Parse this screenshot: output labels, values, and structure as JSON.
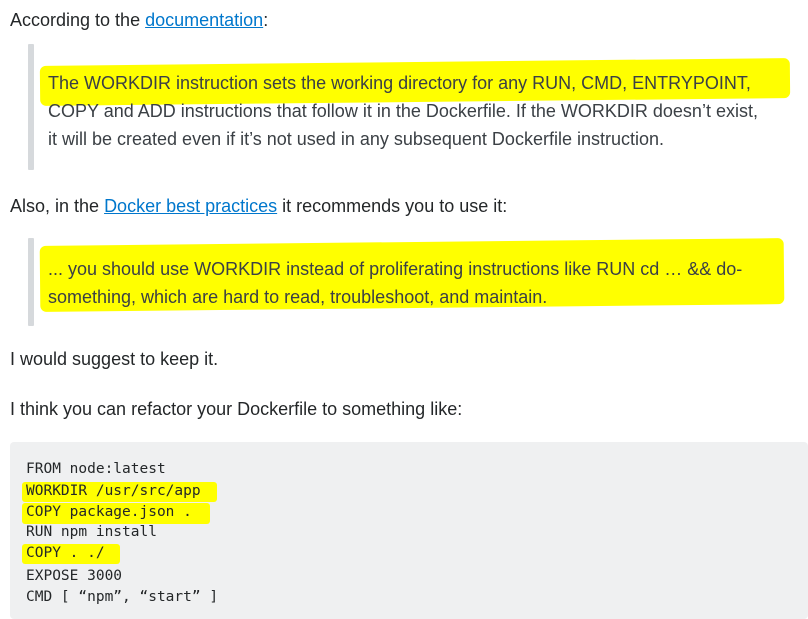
{
  "intro": {
    "prefix": "According to the ",
    "link_text": "documentation",
    "suffix": ":"
  },
  "quote1": {
    "lines": [
      "The WORKDIR instruction sets the working directory for any RUN, CMD, ENTRYPOINT,",
      "COPY and ADD instructions that follow it in the Dockerfile. If the WORKDIR doesn’t exist,",
      "it will be created even if it’s not used in any subsequent Dockerfile instruction."
    ]
  },
  "also": {
    "prefix": "Also, in the ",
    "link_text": "Docker best practices",
    "suffix": " it recommends you to use it:"
  },
  "quote2": {
    "lines": [
      "... you should use WORKDIR instead of proliferating instructions like RUN cd … && do-",
      "something, which are hard to read, troubleshoot, and maintain."
    ]
  },
  "suggest": "I would suggest to keep it.",
  "refactor": "I think you can refactor your Dockerfile to something like:",
  "code": {
    "lines": [
      "FROM node:latest",
      "WORKDIR /usr/src/app",
      "COPY package.json .",
      "RUN npm install",
      "COPY . ./",
      "EXPOSE 3000",
      "CMD [ “npm”, “start” ]"
    ]
  },
  "colors": {
    "highlight": "#ffff00",
    "link": "#0077cc",
    "code_background": "#eff0f1",
    "quote_bar": "#d6d9dc"
  }
}
